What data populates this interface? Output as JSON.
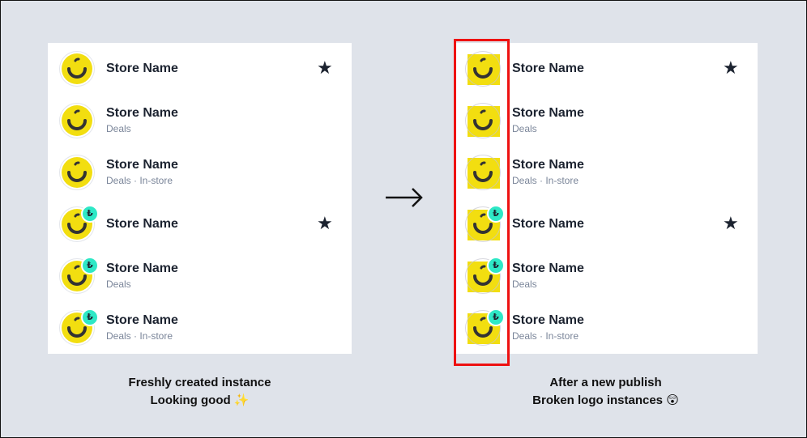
{
  "left": {
    "caption_line1": "Freshly created instance",
    "caption_line2": "Looking good ✨",
    "rows": [
      {
        "name": "Store Name",
        "subtitle": "",
        "badge": "",
        "star": "★"
      },
      {
        "name": "Store Name",
        "subtitle": "Deals",
        "badge": "",
        "star": ""
      },
      {
        "name": "Store Name",
        "subtitle": "Deals · In-store",
        "badge": "",
        "star": ""
      },
      {
        "name": "Store Name",
        "subtitle": "",
        "badge": "₺",
        "star": "★"
      },
      {
        "name": "Store Name",
        "subtitle": "Deals",
        "badge": "₺",
        "star": ""
      },
      {
        "name": "Store Name",
        "subtitle": "Deals · In-store",
        "badge": "₺",
        "star": ""
      }
    ]
  },
  "right": {
    "caption_line1": "After a new publish",
    "caption_line2": "Broken logo instances 😲",
    "rows": [
      {
        "name": "Store Name",
        "subtitle": "",
        "badge": "",
        "star": "★"
      },
      {
        "name": "Store Name",
        "subtitle": "Deals",
        "badge": "",
        "star": ""
      },
      {
        "name": "Store Name",
        "subtitle": "Deals · In-store",
        "badge": "",
        "star": ""
      },
      {
        "name": "Store Name",
        "subtitle": "",
        "badge": "₺",
        "star": "★"
      },
      {
        "name": "Store Name",
        "subtitle": "Deals",
        "badge": "₺",
        "star": ""
      },
      {
        "name": "Store Name",
        "subtitle": "Deals · In-store",
        "badge": "₺",
        "star": ""
      }
    ]
  },
  "arrow": "→",
  "colors": {
    "logo_yellow": "#f2de10",
    "badge_teal": "#2ee8c6",
    "highlight_red": "#ee1111",
    "background": "#dfe3ea"
  }
}
